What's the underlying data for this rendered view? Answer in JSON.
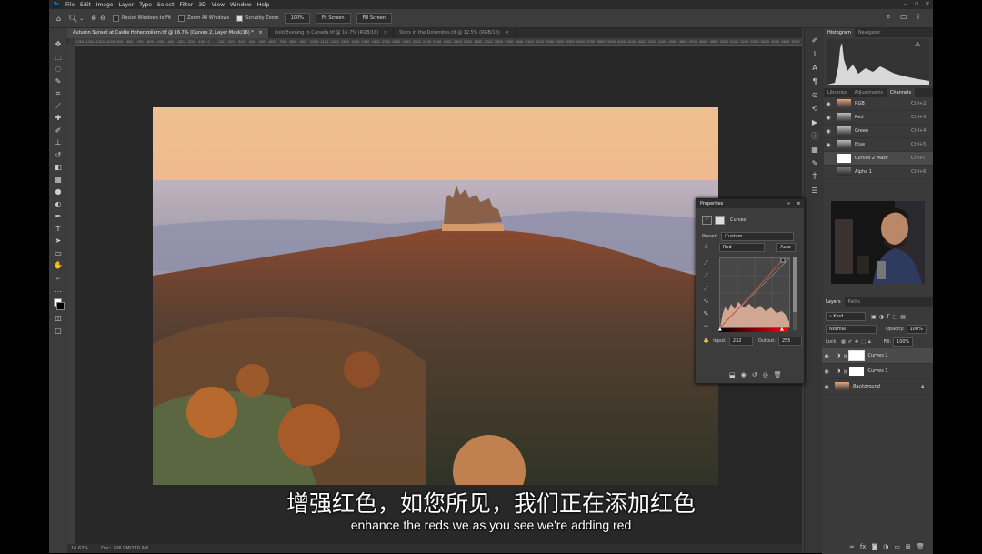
{
  "menubar": {
    "items": [
      "File",
      "Edit",
      "Image",
      "Layer",
      "Type",
      "Select",
      "Filter",
      "3D",
      "View",
      "Window",
      "Help"
    ]
  },
  "options": {
    "resize_windows": "Resize Windows to Fit",
    "zoom_all": "Zoom All Windows",
    "scrubby_zoom": "Scrubby Zoom",
    "zoom_100": "100%",
    "fit_screen": "Fit Screen",
    "fill_screen": "Fill Screen"
  },
  "tabs": [
    {
      "label": "Autumn Sunset at Castle Hohenzollern.tif @ 16.7% (Curves 2, Layer Mask/16) *"
    },
    {
      "label": "Cold Evening in Canada.tif @ 16.7% (RGB/16)"
    },
    {
      "label": "Stars in the Dolomites.tif @ 12.5% (RGB/16)"
    }
  ],
  "ruler_labels": [
    "-1300",
    "-1200",
    "-1100",
    "-1000",
    "-900",
    "-800",
    "-700",
    "-600",
    "-500",
    "-400",
    "-300",
    "-200",
    "-100",
    "0",
    "100",
    "200",
    "300",
    "400",
    "500",
    "600",
    "700",
    "800",
    "900",
    "1000",
    "1100",
    "1200",
    "1300",
    "1400",
    "1500",
    "1600",
    "1700",
    "1800",
    "1900",
    "2000",
    "2100",
    "2200",
    "2300",
    "2400",
    "2500",
    "2600",
    "2700",
    "2800",
    "2900",
    "3000",
    "3100",
    "3200",
    "3300",
    "3400",
    "3500",
    "3600",
    "3700",
    "3800",
    "3900",
    "4000",
    "4100",
    "4200",
    "4300",
    "4400",
    "4500",
    "4600",
    "4700",
    "4800",
    "4900",
    "5000",
    "5100",
    "5200",
    "5300",
    "5400",
    "5500",
    "5600",
    "5700"
  ],
  "status": {
    "zoom": "16.67%",
    "doc": "Doc: 206.9M/270.9M"
  },
  "panels": {
    "histogram_tab": "Histogram",
    "navigator_tab": "Navigator",
    "libraries_tab": "Libraries",
    "adjustments_tab": "Adjustments",
    "channels_tab": "Channels",
    "channels": [
      {
        "name": "RGB",
        "shortcut": "Ctrl+2"
      },
      {
        "name": "Red",
        "shortcut": "Ctrl+3"
      },
      {
        "name": "Green",
        "shortcut": "Ctrl+4"
      },
      {
        "name": "Blue",
        "shortcut": "Ctrl+5"
      },
      {
        "name": "Curves 2 Mask",
        "shortcut": "Ctrl+\\"
      },
      {
        "name": "Alpha 1",
        "shortcut": "Ctrl+6"
      }
    ]
  },
  "properties": {
    "title": "Properties",
    "type": "Curves",
    "preset_label": "Preset:",
    "preset_value": "Custom",
    "channel_value": "Red",
    "auto_label": "Auto",
    "input_label": "Input:",
    "input_value": "232",
    "output_label": "Output:",
    "output_value": "255"
  },
  "layers": {
    "layers_tab": "Layers",
    "paths_tab": "Paths",
    "kind": "Kind",
    "blend_mode": "Normal",
    "opacity_label": "Opacity:",
    "opacity_value": "100%",
    "lock_label": "Lock:",
    "fill_label": "Fill:",
    "fill_value": "100%",
    "items": [
      {
        "name": "Curves 2"
      },
      {
        "name": "Curves 1"
      },
      {
        "name": "Background"
      }
    ]
  },
  "subtitles": {
    "zh": "增强红色，如您所见，我们正在添加红色",
    "en": "enhance the reds we as you see we're adding red"
  }
}
